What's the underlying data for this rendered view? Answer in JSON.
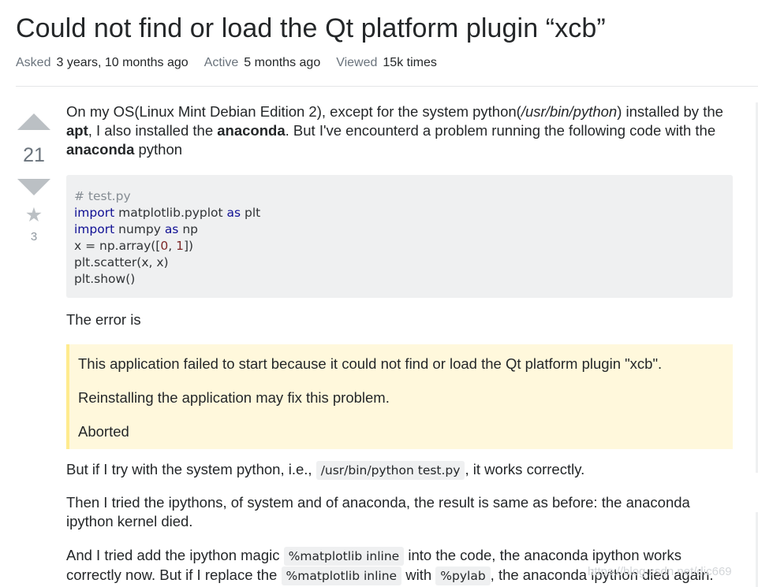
{
  "question": {
    "title": "Could not find or load the Qt platform plugin “xcb”",
    "meta": {
      "asked_label": "Asked",
      "asked_value": "3 years, 10 months ago",
      "active_label": "Active",
      "active_value": "5 months ago",
      "viewed_label": "Viewed",
      "viewed_value": "15k times"
    },
    "votes": {
      "score": "21",
      "favorites": "3"
    },
    "intro": {
      "t1": "On my OS(Linux Mint Debian Edition 2), except for the system python(",
      "path": "/usr/bin/python",
      "t2": ") installed by the ",
      "apt": "apt",
      "t3": ", I also installed the ",
      "anaconda1": "anaconda",
      "t4": ". But I've encounterd a problem running the following code with the ",
      "anaconda2": "anaconda",
      "t5": " python"
    },
    "code": {
      "comment": "# test.py",
      "l2_kw1": "import",
      "l2_mid": " matplotlib.pyplot ",
      "l2_kw2": "as",
      "l2_end": " plt",
      "l3_kw1": "import",
      "l3_mid": " numpy ",
      "l3_kw2": "as",
      "l3_end": " np",
      "l4_a": "x = np.array([",
      "l4_n1": "0",
      "l4_b": ", ",
      "l4_n2": "1",
      "l4_c": "])",
      "l5": "plt.scatter(x, x)",
      "l6": "plt.show()"
    },
    "error_intro": "The error is",
    "error_quote": {
      "line1": "This application failed to start because it could not find or load the Qt platform plugin \"xcb\".",
      "line2": "Reinstalling the application may fix this problem.",
      "line3": "Aborted"
    },
    "para_system": {
      "t1": "But if I try with the system python, i.e., ",
      "code": "/usr/bin/python test.py",
      "t2": ", it works correctly."
    },
    "para_ipython": {
      "line1": "Then I tried the ipythons, of system and of anaconda, the result is same as before: the anaconda",
      "line2": "ipython kernel died."
    },
    "para_magic": {
      "t1": "And I tried add the ipython magic ",
      "code1": "%matplotlib inline",
      "t2": " into the code, the anaconda ipython works",
      "t3": "correctly now. But if I replace the ",
      "code2": "%matplotlib inline",
      "t4": " with ",
      "code3": "%pylab",
      "t5": ", the anaconda ipython died again."
    },
    "watermark": "https://blog.csdn.net/dic669"
  }
}
